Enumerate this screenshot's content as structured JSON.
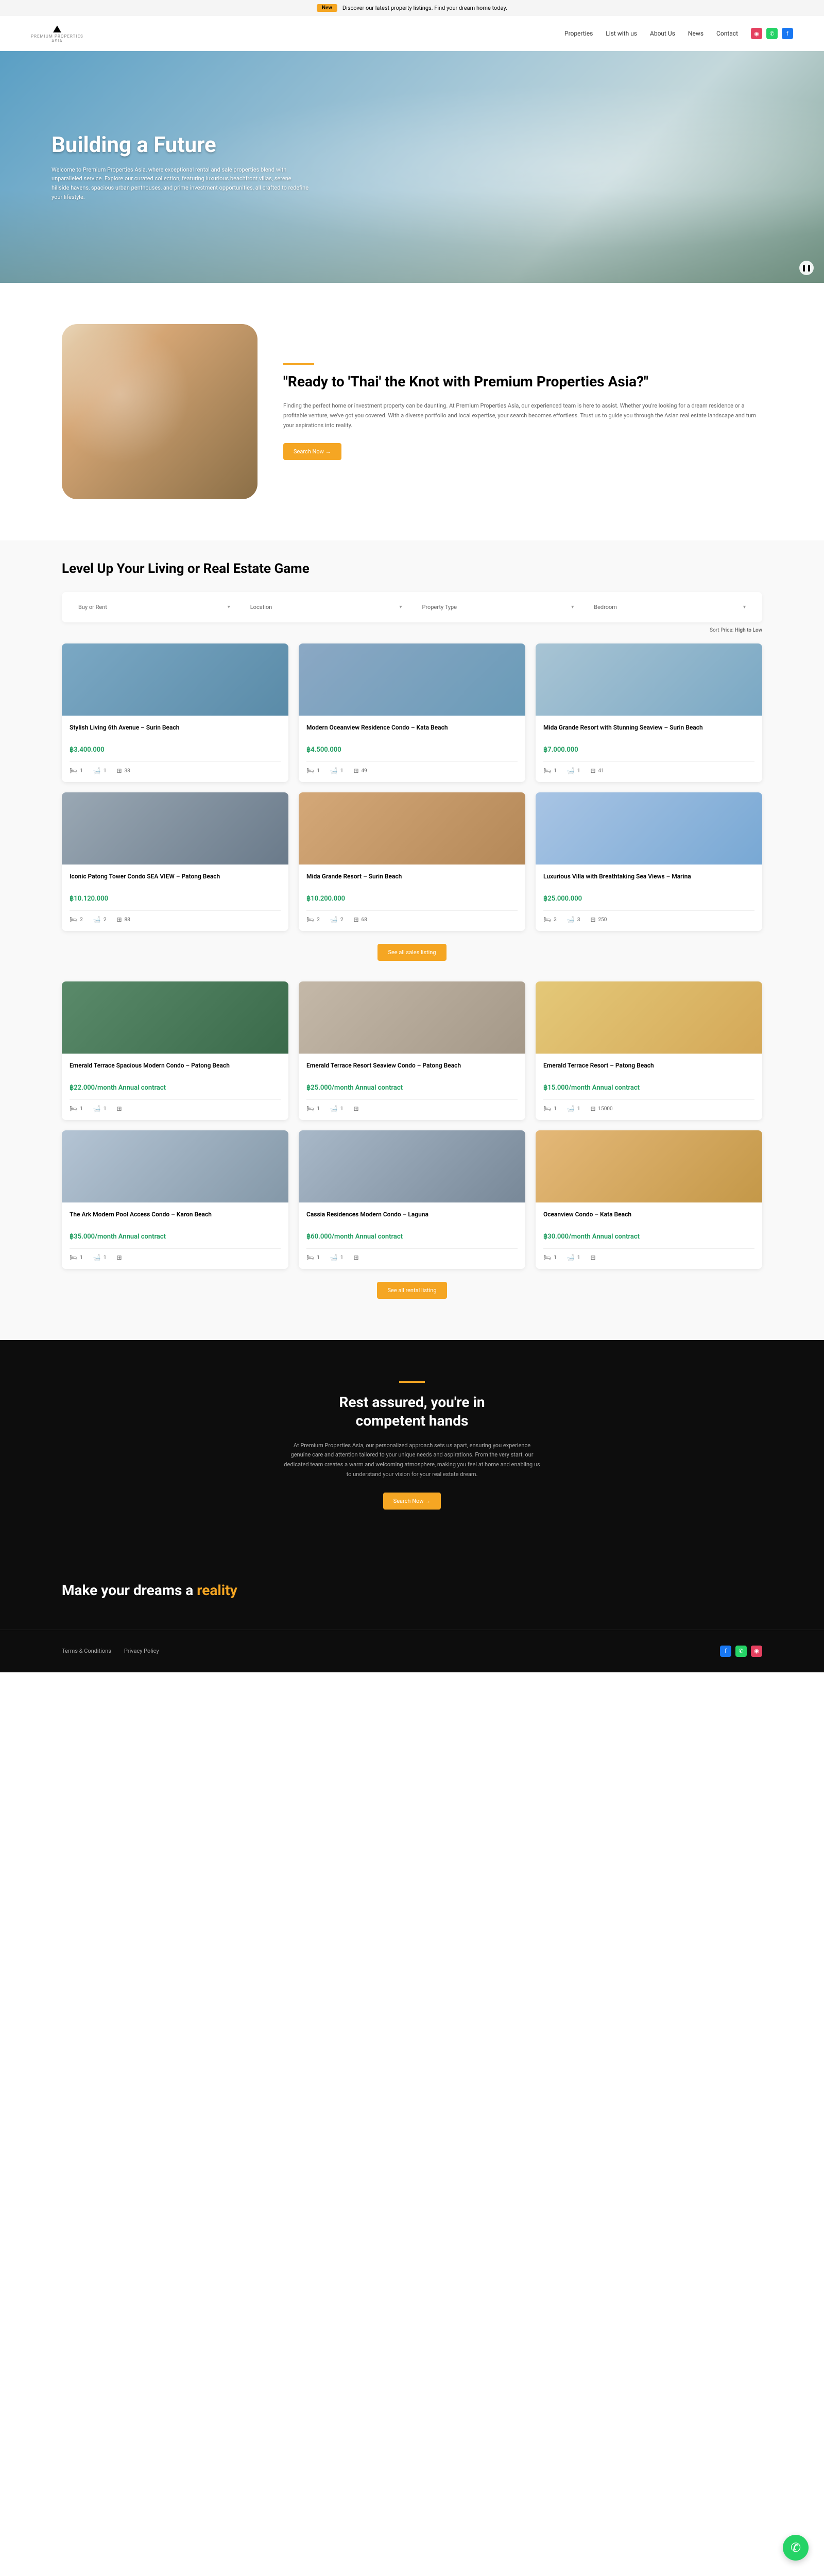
{
  "banner": {
    "tag": "New",
    "text": "Discover our latest property listings. Find your dream home today."
  },
  "logo": {
    "name": "PREMIUM PROPERTIES",
    "sub": "ASIA"
  },
  "nav": {
    "properties": "Properties",
    "list": "List with us",
    "about": "About Us",
    "news": "News",
    "contact": "Contact"
  },
  "hero": {
    "title": "Building a Future",
    "desc": "Welcome to Premium Properties Asia, where exceptional rental and sale properties blend with unparalleled service. Explore our curated collection, featuring luxurious beachfront villas, serene hillside havens, spacious urban penthouses, and prime investment opportunities, all crafted to redefine your lifestyle."
  },
  "intro": {
    "title": "\"Ready to 'Thai' the Knot with Premium Properties Asia?\"",
    "desc": "Finding the perfect home or investment property can be daunting. At Premium Properties Asia, our experienced team is here to assist. Whether you're looking for a dream residence or a profitable venture, we've got you covered. With a diverse portfolio and local expertise, your search becomes effortless. Trust us to guide you through the Asian real estate landscape and turn your aspirations into reality.",
    "btn": "Search Now →"
  },
  "listings": {
    "title": "Level Up Your Living or Real Estate Game",
    "filters": {
      "f1": "Buy or Rent",
      "f2": "Location",
      "f3": "Property Type",
      "f4": "Bedroom"
    },
    "sort": {
      "label": "Sort Price:",
      "value": "High to Low"
    },
    "sales": [
      {
        "title": "Stylish Living 6th Avenue – Surin Beach",
        "price": "฿3.400.000",
        "bed": "1",
        "bath": "1",
        "area": "38"
      },
      {
        "title": "Modern Oceanview Residence Condo – Kata Beach",
        "price": "฿4.500.000",
        "bed": "1",
        "bath": "1",
        "area": "49"
      },
      {
        "title": "Mida Grande Resort with Stunning Seaview – Surin Beach",
        "price": "฿7.000.000",
        "bed": "1",
        "bath": "1",
        "area": "41"
      },
      {
        "title": "Iconic Patong Tower Condo SEA VIEW – Patong Beach",
        "price": "฿10.120.000",
        "bed": "2",
        "bath": "2",
        "area": "88"
      },
      {
        "title": "Mida Grande Resort – Surin Beach",
        "price": "฿10.200.000",
        "bed": "2",
        "bath": "2",
        "area": "68"
      },
      {
        "title": "Luxurious Villa with Breathtaking Sea Views – Marina",
        "price": "฿25.000.000",
        "bed": "3",
        "bath": "3",
        "area": "250"
      }
    ],
    "seeSales": "See all sales listing",
    "rentals": [
      {
        "title": "Emerald Terrace Spacious Modern Condo – Patong Beach",
        "price": "฿22.000/month Annual contract",
        "bed": "1",
        "bath": "1",
        "area": ""
      },
      {
        "title": "Emerald Terrace Resort Seaview Condo – Patong Beach",
        "price": "฿25.000/month Annual contract",
        "bed": "1",
        "bath": "1",
        "area": ""
      },
      {
        "title": "Emerald Terrace Resort – Patong Beach",
        "price": "฿15.000/month Annual contract",
        "bed": "1",
        "bath": "1",
        "area": "15000"
      },
      {
        "title": "The Ark Modern Pool Access Condo – Karon Beach",
        "price": "฿35.000/month Annual contract",
        "bed": "1",
        "bath": "1",
        "area": ""
      },
      {
        "title": "Cassia Residences Modern Condo – Laguna",
        "price": "฿60.000/month Annual contract",
        "bed": "1",
        "bath": "1",
        "area": ""
      },
      {
        "title": "Oceanview Condo – Kata Beach",
        "price": "฿30.000/month Annual contract",
        "bed": "1",
        "bath": "1",
        "area": ""
      }
    ],
    "seeRentals": "See all rental listing"
  },
  "assured": {
    "title1": "Rest assured, you're in",
    "title2": "competent hands",
    "desc": "At Premium Properties Asia, our personalized approach sets us apart, ensuring you experience genuine care and attention tailored to your unique needs and aspirations. From the very start, our dedicated team creates a warm and welcoming atmosphere, making you feel at home and enabling us to understand your vision for your real estate dream.",
    "btn": "Search Now →"
  },
  "dreams": {
    "t1": "Make your dreams a ",
    "t2": "reality"
  },
  "footer": {
    "terms": "Terms & Conditions",
    "privacy": "Privacy Policy"
  }
}
